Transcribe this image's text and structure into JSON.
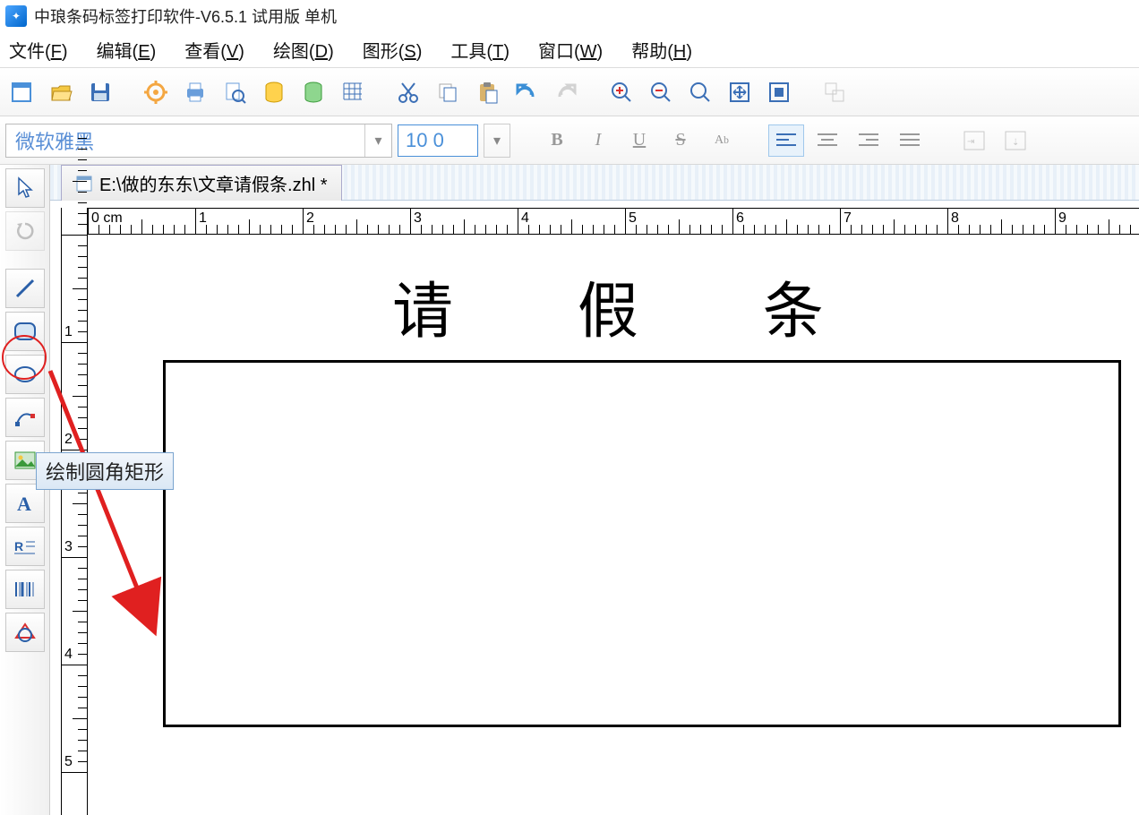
{
  "app": {
    "title": "中琅条码标签打印软件-V6.5.1 试用版 单机"
  },
  "menu": {
    "file": "文件(F)",
    "edit": "编辑(E)",
    "view": "查看(V)",
    "draw": "绘图(D)",
    "shape": "图形(S)",
    "tool": "工具(T)",
    "window": "窗口(W)",
    "help": "帮助(H)"
  },
  "font": {
    "name": "微软雅黑",
    "size": "10 0"
  },
  "document": {
    "path": "E:\\做的东东\\文章请假条.zhl *"
  },
  "canvas": {
    "title_text": "请  假  条"
  },
  "tooltip": {
    "rounded_rect": "绘制圆角矩形"
  },
  "ruler": {
    "unit": "cm",
    "h_labels": [
      "0 cm",
      "1",
      "2",
      "3",
      "4",
      "5",
      "6",
      "7",
      "8",
      "9"
    ],
    "v_labels": [
      "1",
      "2",
      "3",
      "4",
      "5"
    ]
  },
  "colors": {
    "accent_blue": "#4a90d9",
    "highlight_red": "#e02020"
  }
}
